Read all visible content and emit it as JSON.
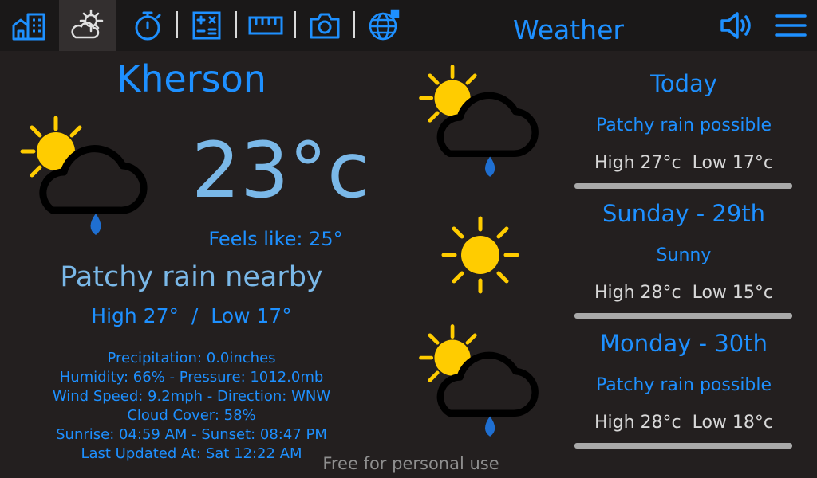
{
  "topbar": {
    "title": "Weather",
    "nav": [
      {
        "icon": "building-icon"
      },
      {
        "icon": "weather-icon",
        "active": true
      },
      {
        "icon": "stopwatch-icon"
      },
      {
        "icon": "calculator-icon"
      },
      {
        "icon": "ruler-icon"
      },
      {
        "icon": "camera-icon"
      },
      {
        "icon": "globe-icon"
      }
    ],
    "right_icons": [
      "speaker-icon",
      "menu-icon"
    ]
  },
  "current": {
    "city": "Kherson",
    "temperature": "23°c",
    "feels_like": "Feels like: 25°",
    "condition": "Patchy rain nearby",
    "high_low": "High 27°  /  Low 17°",
    "icon": "sun-cloud-rain-icon",
    "details": [
      "Precipitation: 0.0inches",
      "Humidity: 66% - Pressure: 1012.0mb",
      "Wind Speed: 9.2mph - Direction: WNW",
      "Cloud Cover: 58%",
      "Sunrise: 04:59 AM - Sunset: 08:47 PM",
      "Last Updated At:  Sat 12:22 AM"
    ]
  },
  "forecast": [
    {
      "day": "Today",
      "condition": "Patchy rain possible",
      "high_low": "High 27°c  Low 17°c",
      "icon": "sun-cloud-rain-icon"
    },
    {
      "day": "Sunday - 29th",
      "condition": "Sunny",
      "high_low": "High 28°c  Low 15°c",
      "icon": "sun-icon"
    },
    {
      "day": "Monday - 30th",
      "condition": "Patchy rain possible",
      "high_low": "High 28°c  Low 18°c",
      "icon": "sun-cloud-rain-icon"
    }
  ],
  "watermark": "Free for personal use",
  "colors": {
    "background": "#231f1f",
    "topbar": "#1a1818",
    "accent": "#1e90ff",
    "light_accent": "#7ab8e8",
    "sun": "#ffcc00",
    "raindrop": "#1f6fd1"
  }
}
